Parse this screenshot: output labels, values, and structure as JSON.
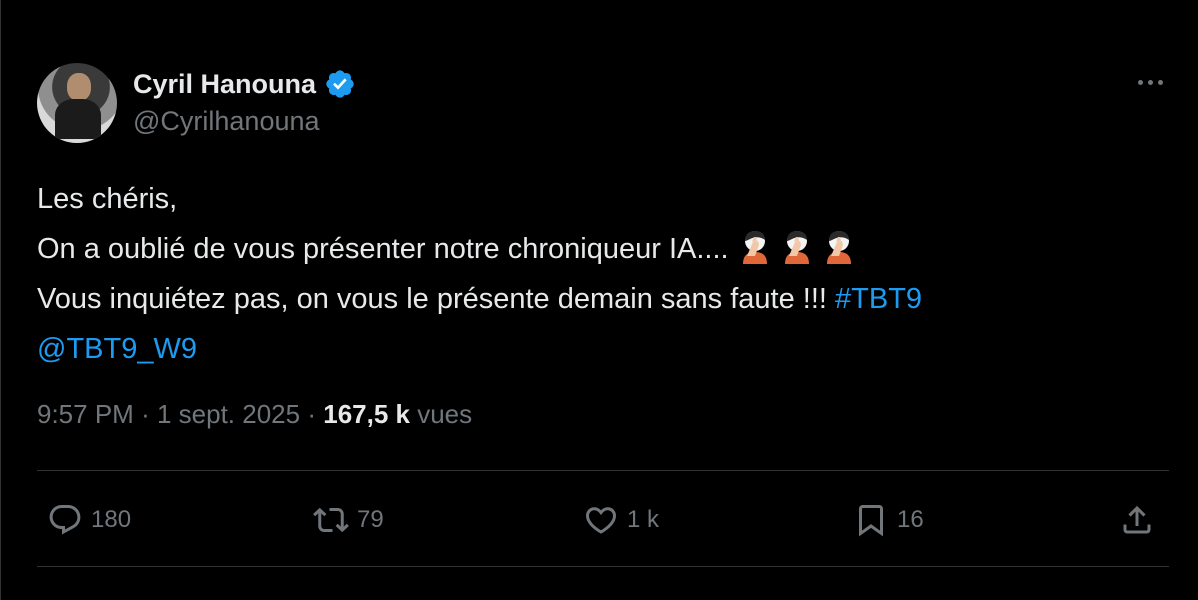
{
  "author": {
    "display_name": "Cyril Hanouna",
    "handle": "@Cyrilhanouna",
    "verified": true
  },
  "tweet": {
    "lines": [
      "Les chéris,",
      "On a oublié de vous présenter notre chroniqueur IA....",
      "Vous inquiétez pas, on vous le présente demain sans faute !!!"
    ],
    "hashtag": "#TBT9",
    "mention": "@TBT9_W9",
    "emoji_count": 3,
    "emoji_name": "face-palm"
  },
  "meta": {
    "time": "9:57 PM",
    "separator": "·",
    "date": "1 sept. 2025",
    "views_count": "167,5 k",
    "views_label": "vues"
  },
  "actions": {
    "replies": "180",
    "reposts": "79",
    "likes": "1 k",
    "bookmarks": "16"
  },
  "colors": {
    "background": "#000000",
    "text": "#e7e9ea",
    "muted": "#71767b",
    "link": "#1d9bf0",
    "divider": "#2f3336"
  }
}
